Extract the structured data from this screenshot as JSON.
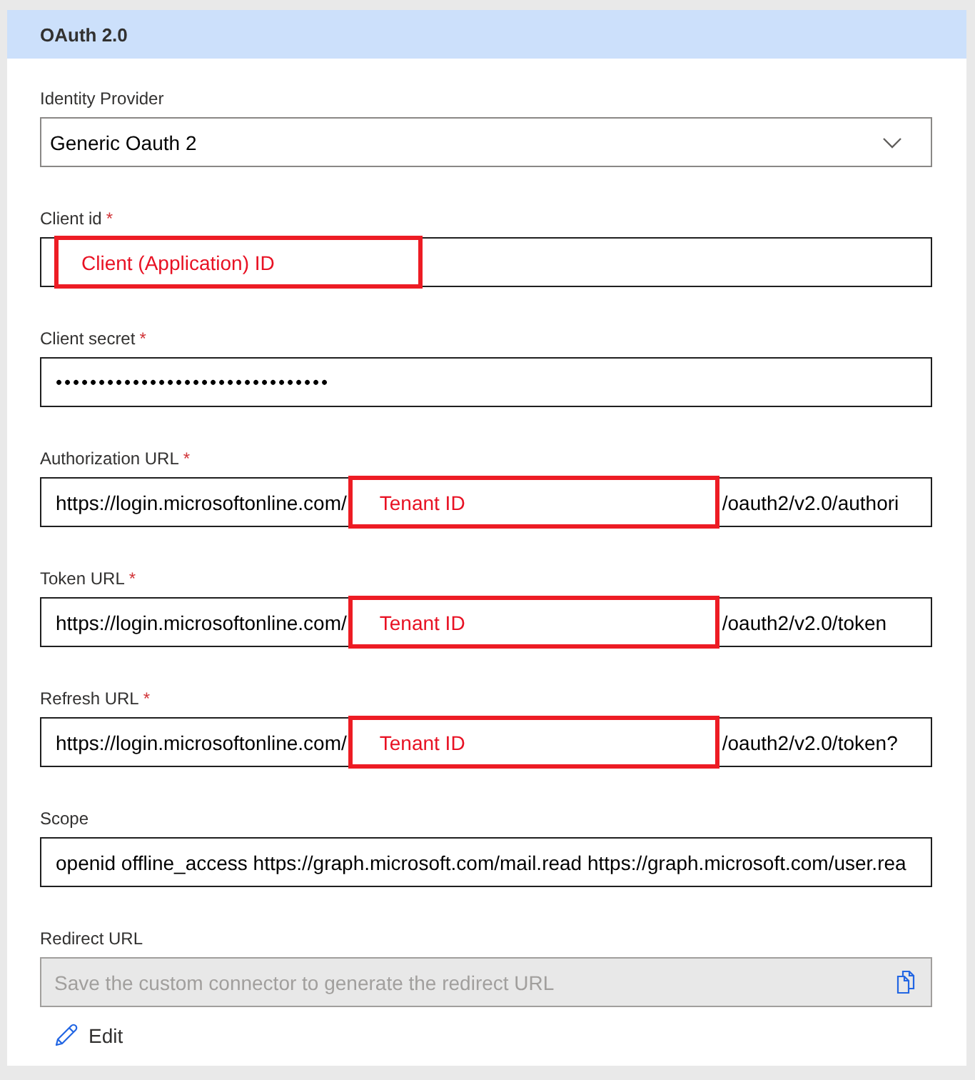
{
  "section": {
    "title": "OAuth 2.0"
  },
  "fields": [
    {
      "kind": "dropdown",
      "label": "Identity Provider",
      "disabled": false,
      "value": "Generic Oauth 2"
    },
    {
      "kind": "text",
      "label": "Client id",
      "required_mark": "*",
      "disabled": false,
      "annotation": "Client (Application) ID"
    },
    {
      "kind": "password",
      "label": "Client secret",
      "required_mark": "*",
      "disabled": false,
      "value": "••••••••••••••••••••••••••••••••"
    },
    {
      "kind": "url",
      "label": "Authorization URL",
      "required_mark": "*",
      "disabled": false,
      "value_prefix": "https://login.microsoftonline.com/",
      "annotation": "Tenant ID",
      "value_suffix": "/oauth2/v2.0/authori"
    },
    {
      "kind": "url",
      "label": "Token URL",
      "required_mark": "*",
      "disabled": false,
      "value_prefix": "https://login.microsoftonline.com/",
      "annotation": "Tenant ID",
      "value_suffix": "/oauth2/v2.0/token"
    },
    {
      "kind": "url",
      "label": "Refresh URL",
      "required_mark": "*",
      "disabled": false,
      "value_prefix": "https://login.microsoftonline.com/",
      "annotation": "Tenant ID",
      "value_suffix": "/oauth2/v2.0/token?"
    },
    {
      "kind": "text",
      "label": "Scope",
      "disabled": false,
      "value": "openid offline_access https://graph.microsoft.com/mail.read https://graph.microsoft.com/user.rea"
    },
    {
      "kind": "copy",
      "label": "Redirect URL",
      "disabled": true,
      "placeholder": "Save the custom connector to generate the redirect URL"
    }
  ],
  "edit_button": {
    "label": "Edit"
  }
}
